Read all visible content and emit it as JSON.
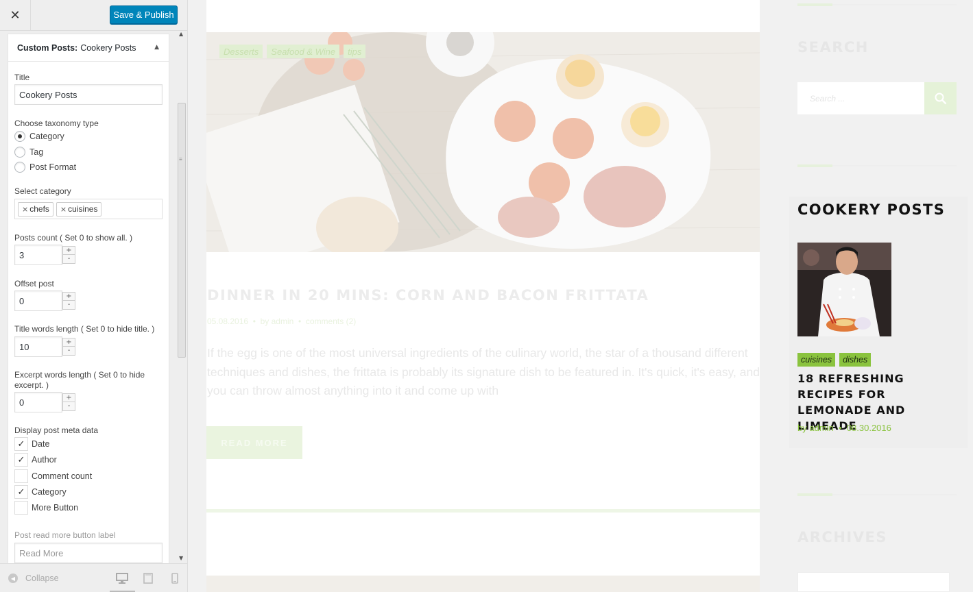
{
  "customizer": {
    "close_icon": "close-icon",
    "save_label": "Save & Publish",
    "widget": {
      "header_bold": "Custom Posts:",
      "header_name": "Cookery Posts",
      "title_label": "Title",
      "title_value": "Cookery Posts",
      "taxonomy_label": "Choose taxonomy type",
      "taxonomy_options": [
        "Category",
        "Tag",
        "Post Format"
      ],
      "taxonomy_selected": "Category",
      "category_label": "Select category",
      "categories": [
        "chefs",
        "cuisines"
      ],
      "posts_count_label": "Posts count ( Set 0 to show all. )",
      "posts_count_value": "3",
      "offset_label": "Offset post",
      "offset_value": "0",
      "title_words_label": "Title words length ( Set 0 to hide title. )",
      "title_words_value": "10",
      "excerpt_label_1": "Excerpt words length ( Set 0 to hide",
      "excerpt_label_2": "excerpt. )",
      "excerpt_value": "0",
      "meta_label": "Display post meta data",
      "meta_options": [
        {
          "label": "Date",
          "checked": true
        },
        {
          "label": "Author",
          "checked": true
        },
        {
          "label": "Comment count",
          "checked": false
        },
        {
          "label": "Category",
          "checked": true
        },
        {
          "label": "More Button",
          "checked": false
        }
      ],
      "readmore_label": "Post read more button label",
      "readmore_placeholder": "Read More",
      "spin_plus": "+",
      "spin_minus": "-"
    },
    "footer": {
      "collapse_label": "Collapse",
      "devices": [
        "desktop",
        "tablet",
        "mobile"
      ]
    }
  },
  "preview": {
    "post": {
      "tags": [
        "Desserts",
        "Seafood & Wine",
        "tips"
      ],
      "title": "DINNER IN 20 MINS: CORN AND BACON FRITTATA",
      "date": "05.08.2016",
      "author": "by admin",
      "comments": "comments (2)",
      "excerpt": "If the egg is one of the most universal ingredients of the culinary world, the star of a thousand different techniques and dishes, the frittata is probably its signature dish to be featured in. It's quick, it's easy, and you can throw almost anything into it and come up with",
      "read_more": "READ MORE"
    },
    "sidebar": {
      "search_title": "SEARCH",
      "search_placeholder": "Search ...",
      "cookery_title": "COOKERY POSTS",
      "cookery_post": {
        "tags": [
          "cuisines",
          "dishes"
        ],
        "title": "18 REFRESHING RECIPES FOR LEMONADE AND LIMEADE",
        "by": "by",
        "author": "admin",
        "date": "08.30.2016"
      },
      "archives_title": "ARCHIVES"
    },
    "colors": {
      "accent": "#8ac33e",
      "publish": "#0085ba"
    }
  }
}
